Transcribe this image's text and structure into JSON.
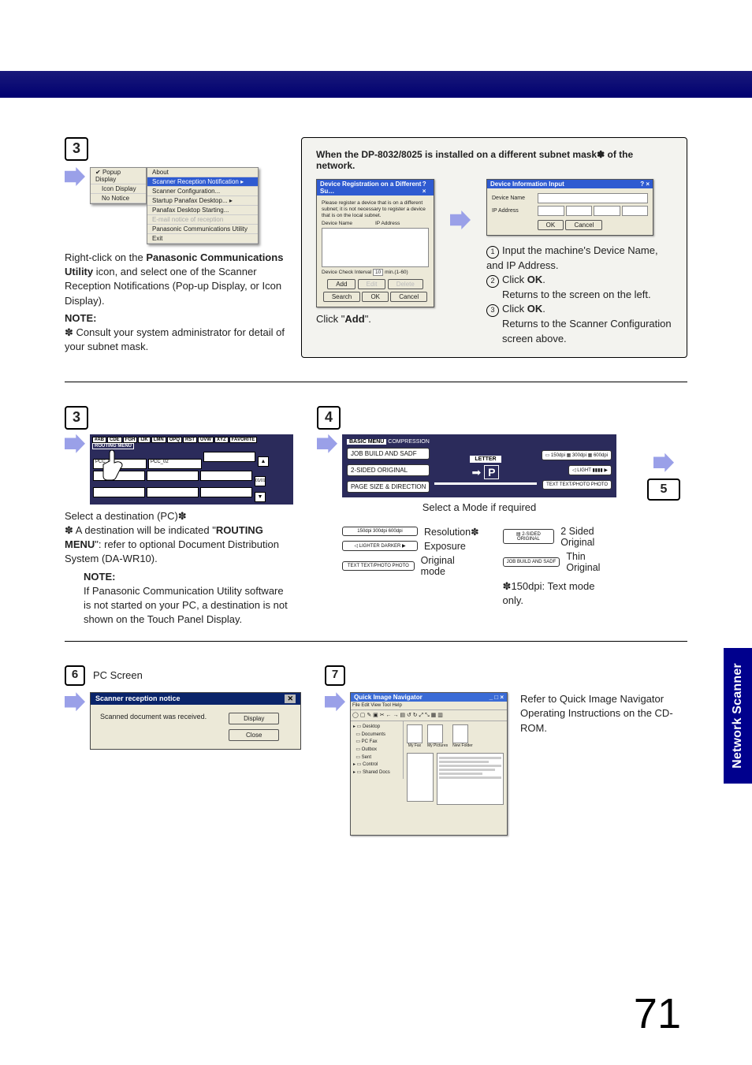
{
  "banner": "",
  "step3a": {
    "num": "3",
    "menu_left": [
      "Popup Display",
      "Icon Display",
      "No Notice"
    ],
    "menu_top": "About",
    "menu_right": [
      "Scanner Reception Notification",
      "Scanner Configuration...",
      "Startup Panafax Desktop...",
      "Panafax Desktop Starting...",
      "E-mail notice of reception",
      "Panasonic Communications Utility",
      "Exit"
    ],
    "text1a": "Right-click on the ",
    "text1b": "Panasonic Communications Utility",
    "text1c": " icon, and select one of the Scanner Reception Notifications (Pop-up Display, or Icon Display).",
    "note_lbl": "NOTE:",
    "note_body": "✽ Consult your system administrator for detail of your subnet mask."
  },
  "subnetPanel": {
    "title": "When the DP-8032/8025 is installed on a different subnet mask✽ of the network.",
    "left": {
      "win_title": "Device Registration on a Different Su…",
      "instr": "Please register a device that is on a different subnet; it is not necessary to register a device that is on the local subnet.",
      "col1": "Device Name",
      "col2": "IP Address",
      "interval": "Device Check Interval",
      "interval_val": "10",
      "interval_unit": "min.(1-60)",
      "btn_add": "Add",
      "btn_edit": "Edit",
      "btn_delete": "Delete",
      "btn_search": "Search",
      "btn_ok": "OK",
      "btn_cancel": "Cancel",
      "foot_pre": "Click \"",
      "foot_bold": "Add",
      "foot_post": "\"."
    },
    "right": {
      "win_title": "Device Information Input",
      "lbl_name": "Device Name",
      "lbl_ip": "IP Address",
      "btn_ok": "OK",
      "btn_cancel": "Cancel",
      "s1": "Input the machine's Device Name, and IP Address.",
      "s2a": "Click ",
      "s2b": "OK",
      "s2c": ".",
      "s2d": "Returns to the screen on the left.",
      "s3a": "Click ",
      "s3b": "OK",
      "s3c": ".",
      "s3d": "Returns to the Scanner Configuration screen above."
    }
  },
  "step3b": {
    "num": "3",
    "tabs": [
      "#AB",
      "CDE",
      "FGH",
      "IJK",
      "LMN",
      "OPQ",
      "RST",
      "UVW",
      "XYZ",
      "FAVORITE",
      "ROUTING MENU"
    ],
    "dest1": "PCC_01",
    "dest2": "PCC_02",
    "l1": "Select a destination (PC)✽",
    "l2pre": "✽  A destination will be indicated \"",
    "l2bold": "ROUTING MENU",
    "l2post": "\": refer to optional Document Distribution System (DA-WR10).",
    "note_lbl": "NOTE:",
    "note_body": "If Panasonic Communication Utility software is not started on your PC, a destination is not shown on the Touch Panel Display."
  },
  "step4": {
    "num": "4",
    "lcd_tabs": [
      "BASIC MENU",
      "COMPRESSION"
    ],
    "lcd_letter": "LETTER",
    "lcd_600": "600dpi",
    "btn_job": "JOB BUILD AND SADF",
    "btn_2sided": "2-SIDED ORIGINAL",
    "btn_pagesize": "PAGE SIZE & DIRECTION",
    "caption": "Select a Mode if required",
    "r1_icon": "150dpi 300dpi 600dpi",
    "r1": "Resolution✽",
    "r2_icon": "LIGHTER   DARKER",
    "r2": "Exposure",
    "r3_icon": "TEXT TEXT/PHOTO PHOTO",
    "r3": "Original mode",
    "r4_icon": "2-SIDED ORIGINAL",
    "r4": "2 Sided Original",
    "r5_icon": "JOB BUILD AND SADF",
    "r5": "Thin Original",
    "foot": "✽150dpi: Text mode only."
  },
  "step5": {
    "num": "5"
  },
  "step6": {
    "num": "6",
    "title": "PC Screen",
    "win_title": "Scanner reception notice",
    "msg": "Scanned document was received.",
    "btn1": "Display",
    "btn2": "Close"
  },
  "step7": {
    "num": "7",
    "text": "Refer to Quick Image Navigator Operating Instructions on the CD-ROM."
  },
  "side": "Network Scanner",
  "pagenum": "71"
}
